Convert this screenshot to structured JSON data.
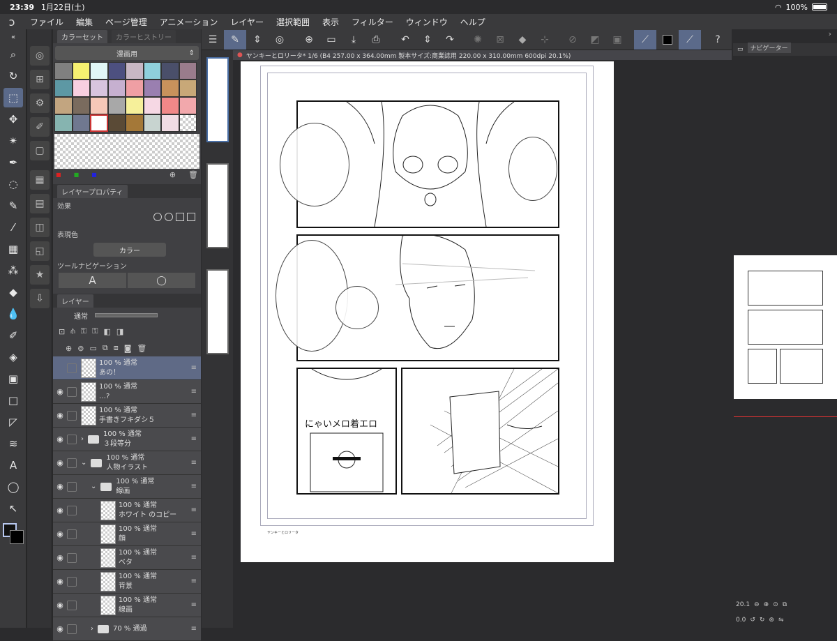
{
  "status": {
    "time": "23:39",
    "date": "1月22日(土)",
    "battery": "100%"
  },
  "menu": [
    "ファイル",
    "編集",
    "ページ管理",
    "アニメーション",
    "レイヤー",
    "選択範囲",
    "表示",
    "フィルター",
    "ウィンドウ",
    "ヘルプ"
  ],
  "color_panel": {
    "tab_active": "カラーセット",
    "tab_inactive": "カラーヒストリー",
    "set_name": "漫画用",
    "swatches": [
      "#808080",
      "#f6f071",
      "#e0f6f6",
      "#4d5080",
      "#c8b7c4",
      "#8fd0dc",
      "#4a4f6a",
      "#9a7c8c",
      "#5d98a4",
      "#f8cfe0",
      "#d8c4de",
      "#c6b0d0",
      "#ef9fa4",
      "#9a7fb0",
      "#c8925c",
      "#c8a878",
      "#c2a580",
      "#7a6b5e",
      "#f6c8b8",
      "#a8a8a8",
      "#f6f09a",
      "#f6d8e4",
      "#f08888",
      "#f2a8ac",
      "#86b4b0",
      "#707890",
      "#ffffff",
      "#5a4a36",
      "#a47838",
      "#c8d4d0",
      "#f0dce4",
      "checker"
    ]
  },
  "layer_property": {
    "tab": "レイヤープロパティ",
    "effect_label": "効果",
    "color_label": "表現色",
    "color_value": "カラー",
    "toolnav_label": "ツールナビゲーション",
    "text_tool": "A"
  },
  "layers_panel": {
    "tab": "レイヤー",
    "blend": "通常",
    "layers": [
      {
        "opacity": "100 %",
        "mode": "通常",
        "name": "あの！",
        "active": true,
        "indent": 0,
        "kind": "text"
      },
      {
        "opacity": "100 %",
        "mode": "通常",
        "name": "…?",
        "active": false,
        "indent": 0,
        "kind": "balloon"
      },
      {
        "opacity": "100 %",
        "mode": "通常",
        "name": "手書きフキダシ５",
        "active": false,
        "indent": 0,
        "kind": "vector"
      },
      {
        "opacity": "100 %",
        "mode": "通常",
        "name": "３段等分",
        "active": false,
        "indent": 0,
        "kind": "folder"
      },
      {
        "opacity": "100 %",
        "mode": "通常",
        "name": "人物イラスト",
        "active": false,
        "indent": 0,
        "kind": "folder-open"
      },
      {
        "opacity": "100 %",
        "mode": "通常",
        "name": "線画",
        "active": false,
        "indent": 1,
        "kind": "folder-open"
      },
      {
        "opacity": "100 %",
        "mode": "通常",
        "name": "ホワイト のコピー",
        "active": false,
        "indent": 2,
        "kind": "raster"
      },
      {
        "opacity": "100 %",
        "mode": "通常",
        "name": "顔",
        "active": false,
        "indent": 2,
        "kind": "vector"
      },
      {
        "opacity": "100 %",
        "mode": "通常",
        "name": "ベタ",
        "active": false,
        "indent": 2,
        "kind": "vector"
      },
      {
        "opacity": "100 %",
        "mode": "通常",
        "name": "背景",
        "active": false,
        "indent": 2,
        "kind": "vector"
      },
      {
        "opacity": "100 %",
        "mode": "通常",
        "name": "線画",
        "active": false,
        "indent": 2,
        "kind": "vector"
      },
      {
        "opacity": "70 %",
        "mode": "通過",
        "name": "",
        "active": false,
        "indent": 1,
        "kind": "folder"
      }
    ]
  },
  "document": {
    "title": "ヤンキーとロリータ* 1/6 (B4 257.00 x 364.00mm 製本サイズ:商業誌用 220.00 x 310.00mm 600dpi 20.1%)",
    "footer_text": "ヤンキーとロリータ",
    "shirt_text": "にゃいメロ着エロ"
  },
  "navigator": {
    "tab": "ナビゲーター",
    "zoom": "20.1",
    "angle": "0.0"
  }
}
